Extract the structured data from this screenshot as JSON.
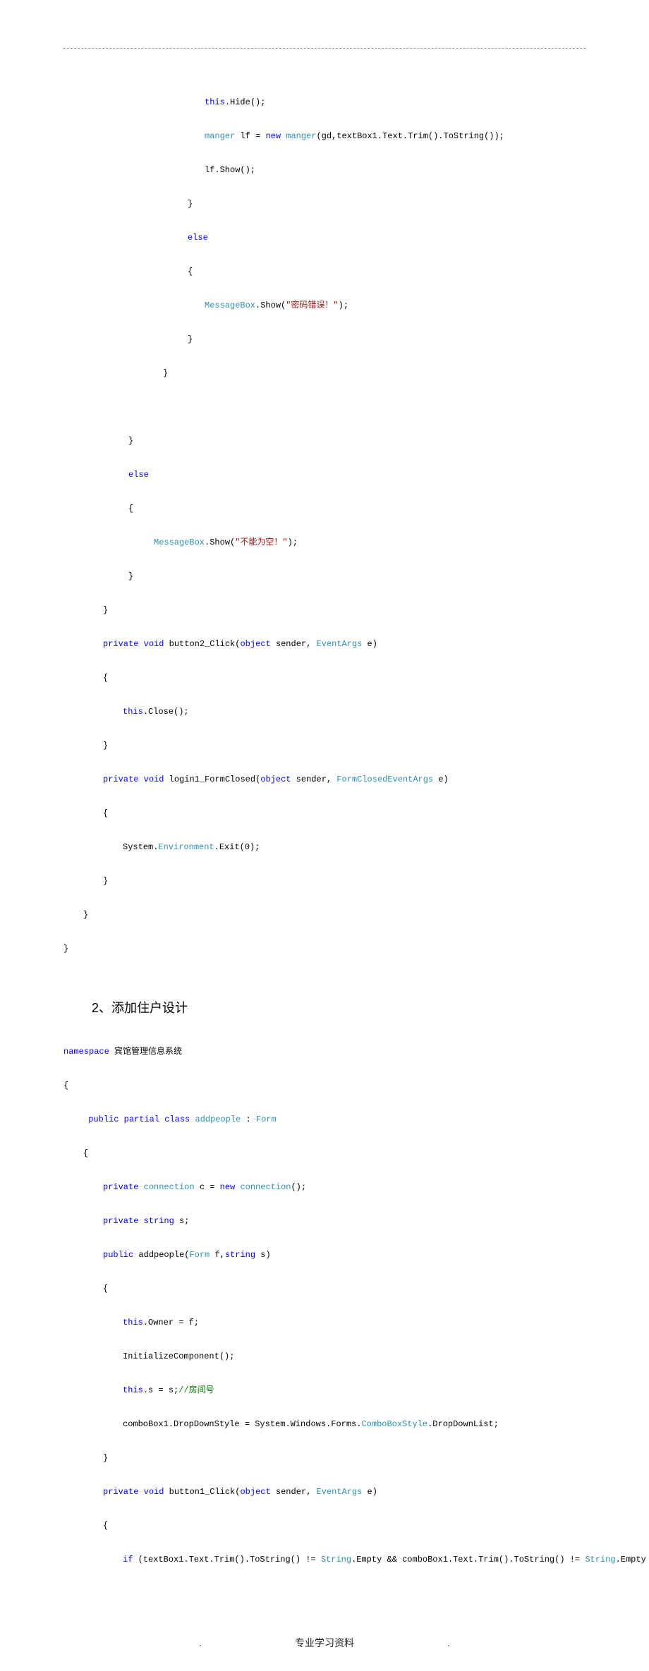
{
  "block1": {
    "l1a": "this",
    "l1b": ".Hide();",
    "l2a": "manger",
    "l2b": " lf = ",
    "l2c": "new",
    "l2d": " ",
    "l2e": "manger",
    "l2f": "(gd,textBox1.Text.Trim().ToString());",
    "l3": "lf.Show();",
    "l4": "}",
    "l5": "else",
    "l6": "{",
    "l7a": "MessageBox",
    "l7b": ".Show(",
    "l7c": "\"密码错误！\"",
    "l7d": ");",
    "l8": "}",
    "l9": "}",
    "l10": "}",
    "l11": "else",
    "l12": "{",
    "l13a": "MessageBox",
    "l13b": ".Show(",
    "l13c": "\"不能为空！\"",
    "l13d": ");",
    "l14": "}",
    "l15": "}",
    "l16a": "private",
    "l16b": " ",
    "l16c": "void",
    "l16d": " button2_Click(",
    "l16e": "object",
    "l16f": " sender, ",
    "l16g": "EventArgs",
    "l16h": " e)",
    "l17": "{",
    "l18a": "this",
    "l18b": ".Close();",
    "l19": "}",
    "l20a": "private",
    "l20b": " ",
    "l20c": "void",
    "l20d": " login1_FormClosed(",
    "l20e": "object",
    "l20f": " sender, ",
    "l20g": "FormClosedEventArgs",
    "l20h": " e)",
    "l21": "{",
    "l22a": "System.",
    "l22b": "Environment",
    "l22c": ".Exit(0);",
    "l23": "}",
    "l24": "}",
    "l25": "}"
  },
  "heading": "2、添加住户设计",
  "block2": {
    "l1a": "namespace",
    "l1b": " 宾馆管理信息系统",
    "l2": "{",
    "l3a": " ",
    "l3b": "public",
    "l3c": " ",
    "l3d": "partial",
    "l3e": " ",
    "l3f": "class",
    "l3g": " ",
    "l3h": "addpeople",
    "l3i": " : ",
    "l3j": "Form",
    "l4": "{",
    "l5a": "private",
    "l5b": " ",
    "l5c": "connection",
    "l5d": " c = ",
    "l5e": "new",
    "l5f": " ",
    "l5g": "connection",
    "l5h": "();",
    "l6a": "private",
    "l6b": " ",
    "l6c": "string",
    "l6d": " s;",
    "l7a": "public",
    "l7b": " addpeople(",
    "l7c": "Form",
    "l7d": " f,",
    "l7e": "string",
    "l7f": " s)",
    "l8": "{",
    "l9a": "this",
    "l9b": ".Owner = f;",
    "l10": "InitializeComponent();",
    "l11a": "this",
    "l11b": ".s = s;",
    "l11c": "//房间号",
    "l12a": "comboBox1.DropDownStyle = System.Windows.Forms.",
    "l12b": "ComboBoxStyle",
    "l12c": ".DropDownList;",
    "l13": "}",
    "l14a": "private",
    "l14b": " ",
    "l14c": "void",
    "l14d": " button1_Click(",
    "l14e": "object",
    "l14f": " sender, ",
    "l14g": "EventArgs",
    "l14h": " e)",
    "l15": "{",
    "l16a": "if",
    "l16b": " (textBox1.Text.Trim().ToString() != ",
    "l16c": "String",
    "l16d": ".Empty && comboBox1.Text.Trim().ToString() != ",
    "l16e": "String",
    "l16f": ".Empty &&"
  },
  "footer": ".                                  专业学习资料                                  ."
}
